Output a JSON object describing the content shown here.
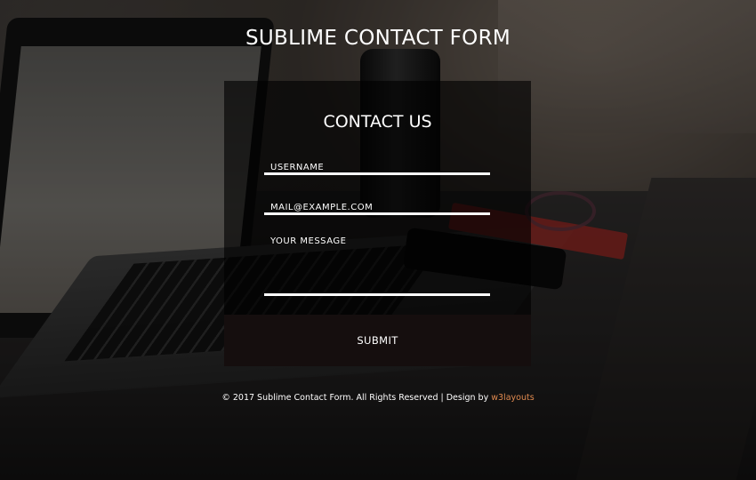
{
  "page": {
    "title": "SUBLIME CONTACT FORM"
  },
  "form": {
    "heading": "CONTACT US",
    "username_placeholder": "USERNAME",
    "email_placeholder": "MAIL@EXAMPLE.COM",
    "message_placeholder": "YOUR MESSAGE",
    "submit_label": "SUBMIT"
  },
  "footer": {
    "text": "© 2017 Sublime Contact Form. All Rights Reserved | Design by ",
    "link_text": "w3layouts",
    "link_color": "#e08a4f"
  },
  "colors": {
    "panel_bg": "rgba(0,0,0,0.62)",
    "button_bg": "#150e0e",
    "text": "#ffffff",
    "accent": "#e08a4f"
  }
}
